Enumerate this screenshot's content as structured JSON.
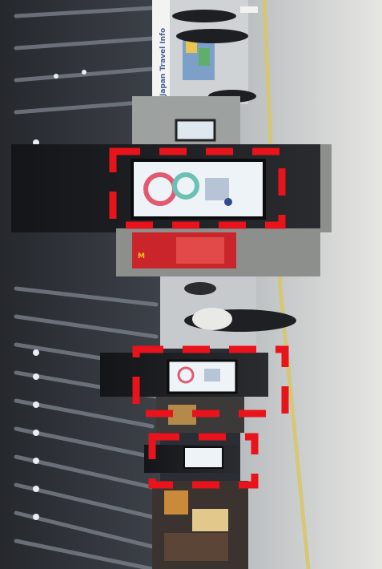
{
  "scene": {
    "orientation": "rotated-90-degrees",
    "colors": {
      "ceiling": "#2c2f35",
      "ceiling_slat": "#5a5f66",
      "floor": "#d9d9d6",
      "floor_stripe": "#d8c56a",
      "pillar": "#1c1d20",
      "pillar_light": "#8d8f8c",
      "screen": "#eef3f7",
      "mcd_red": "#c9252b",
      "mcd_yellow": "#f6c21a",
      "annotation": "#e8131b"
    }
  },
  "signage": {
    "top_banner_text": "Japan Travel Info"
  },
  "annotations": [
    {
      "shape": "dashed-rectangle",
      "target": "digital-signage-large",
      "color": "#e8131b"
    },
    {
      "shape": "dashed-rectangle",
      "target": "digital-signage-middle",
      "color": "#e8131b"
    },
    {
      "shape": "dashed-rectangle",
      "target": "digital-signage-small",
      "color": "#e8131b"
    }
  ]
}
